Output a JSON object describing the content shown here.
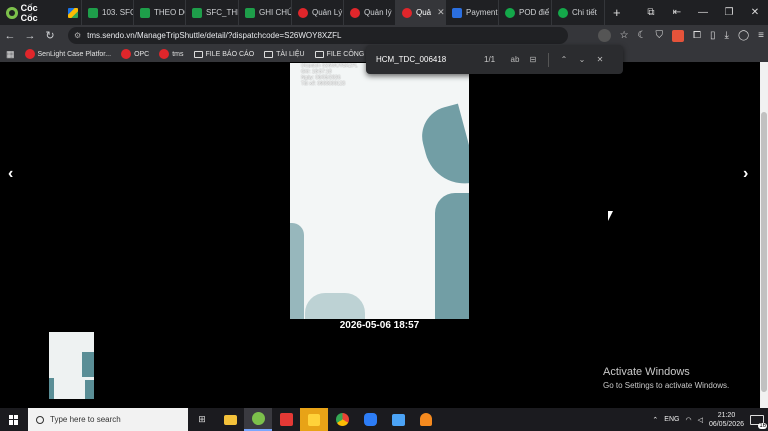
{
  "browser": {
    "brand": "Cốc Cốc",
    "tabs": [
      {
        "label": "",
        "icon": "drive-icon"
      },
      {
        "label": "103. SFC",
        "icon": "sheets-icon"
      },
      {
        "label": "THEO DÕ",
        "icon": "sheets-icon"
      },
      {
        "label": "SFC_THE",
        "icon": "sheets-icon"
      },
      {
        "label": "GHI CHÚ",
        "icon": "sheets-icon"
      },
      {
        "label": "Quản Lý",
        "icon": "sendo-icon"
      },
      {
        "label": "Quản lý",
        "icon": "sendo-icon"
      },
      {
        "label": "Quả",
        "icon": "sendo-icon",
        "active": true
      },
      {
        "label": "Payment",
        "icon": "doc-icon"
      },
      {
        "label": "POD điể",
        "icon": "ghn-icon"
      },
      {
        "label": "Chi tiết",
        "icon": "ghn-icon"
      }
    ],
    "url": "tms.sendo.vn/ManageTripShuttle/detail/?dispatchcode=S26WOY8XZFL",
    "bookmarks": [
      {
        "label": "SenLight Case Platfor...",
        "icon": "sendo-icon"
      },
      {
        "label": "OPC",
        "icon": "sendo-icon"
      },
      {
        "label": "tms",
        "icon": "sendo-icon"
      },
      {
        "label": "FILE BÁO CÁO",
        "icon": "folder-icon"
      },
      {
        "label": "TÀI LIỆU",
        "icon": "folder-icon"
      },
      {
        "label": "FILE CÔNG VIỆC",
        "icon": "folder-icon"
      }
    ]
  },
  "find": {
    "query": "HCM_TDC_006418",
    "count": "1/1",
    "match_case": "ab"
  },
  "viewer": {
    "photo_stamp": [
      "Dispatch S26WOY8XZFL",
      "Giờ: 18:57:18",
      "Ngày: 06/05/2026",
      "Tài xế: 0909000123"
    ],
    "caption": "2026-05-06 18:57",
    "prev": "‹",
    "next": "›"
  },
  "watermark": {
    "title": "Activate Windows",
    "subtitle": "Go to Settings to activate Windows."
  },
  "taskbar": {
    "search_placeholder": "Type here to search",
    "time": "21:20",
    "date": "06/05/2026",
    "notifications": "16",
    "language": "ENG"
  },
  "colors": {
    "tabbar": "#1f2023",
    "toolbar": "#35363a",
    "sendo_red": "#e0262b",
    "sheets_green": "#1e9e4a"
  }
}
